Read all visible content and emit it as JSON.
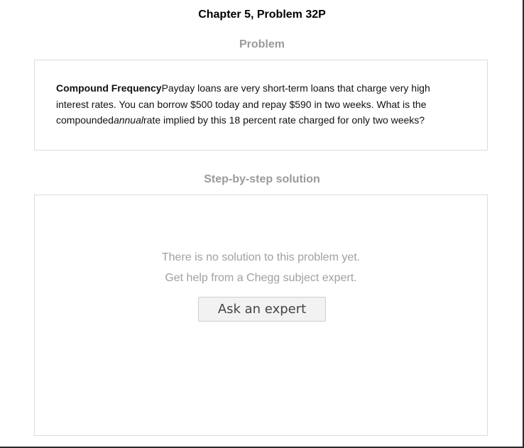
{
  "header": {
    "chapter_title": "Chapter 5, Problem 32P"
  },
  "problem": {
    "heading": "Problem",
    "term": "Compound Frequency",
    "text_part1": "Payday loans are very short-term loans that charge very high interest rates. You can borrow $500 today and repay $590 in two weeks. What is the compounded",
    "emphasis": "annual",
    "text_part2": "rate implied by this 18 percent rate charged for only two weeks?"
  },
  "solution": {
    "heading": "Step-by-step solution",
    "empty_message": "There is no solution to this problem yet.",
    "help_message": "Get help from a Chegg subject expert.",
    "ask_button_label": "Ask an expert"
  }
}
